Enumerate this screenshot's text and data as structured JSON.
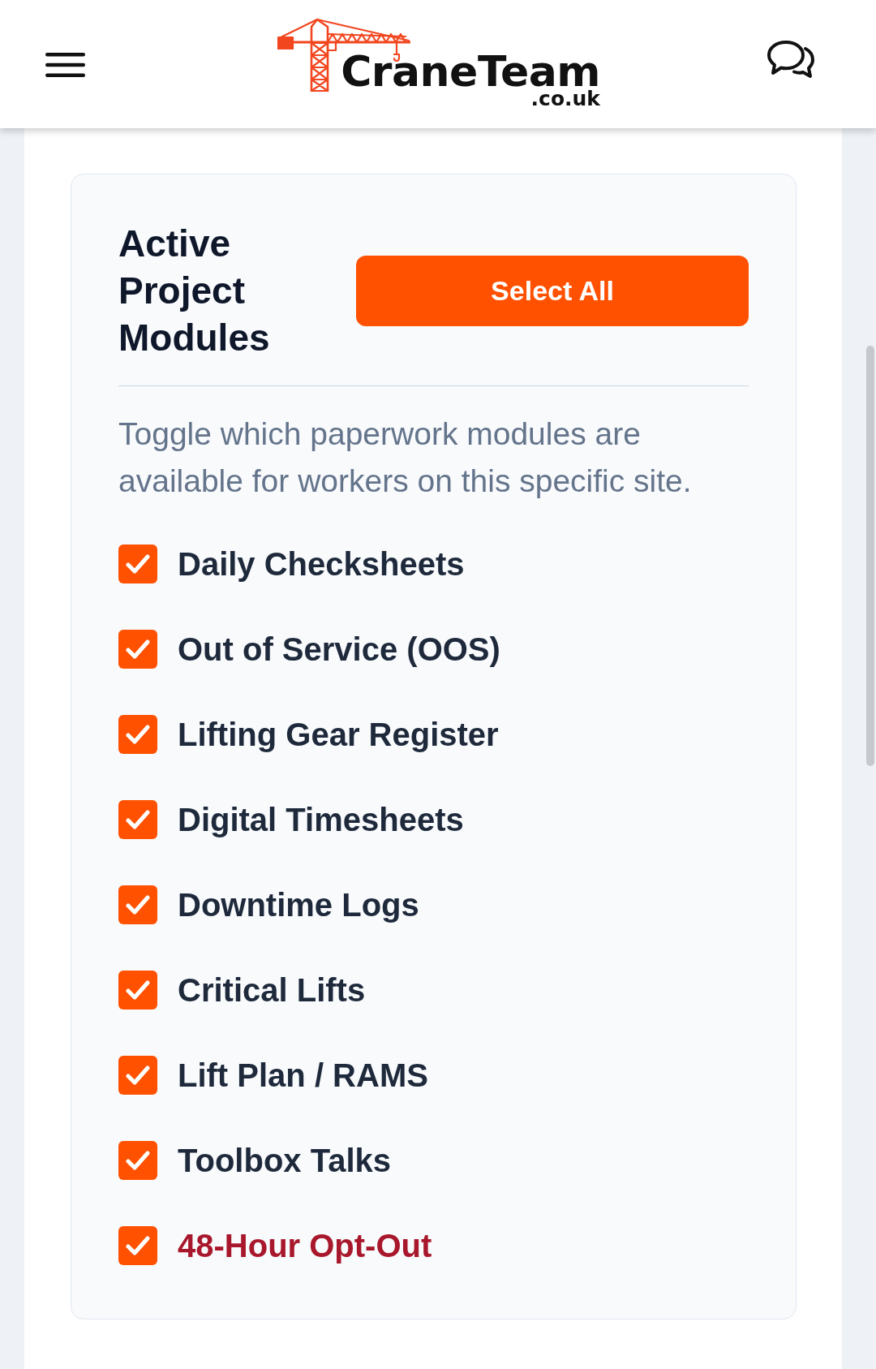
{
  "header": {
    "logo": {
      "name": "CraneTeam",
      "domain": ".co.uk"
    }
  },
  "panel": {
    "title": "Active Project Modules",
    "select_all_button": "Select All",
    "description": "Toggle which paperwork modules are available for workers on this specific site."
  },
  "modules": [
    {
      "label": "Daily Checksheets",
      "checked": true,
      "color": "#1e293b"
    },
    {
      "label": "Out of Service (OOS)",
      "checked": true,
      "color": "#1e293b"
    },
    {
      "label": "Lifting Gear Register",
      "checked": true,
      "color": "#1e293b"
    },
    {
      "label": "Digital Timesheets",
      "checked": true,
      "color": "#1e293b"
    },
    {
      "label": "Downtime Logs",
      "checked": true,
      "color": "#1e293b"
    },
    {
      "label": "Critical Lifts",
      "checked": true,
      "color": "#1e293b"
    },
    {
      "label": "Lift Plan / RAMS",
      "checked": true,
      "color": "#1e293b"
    },
    {
      "label": "Toolbox Talks",
      "checked": true,
      "color": "#1e293b"
    },
    {
      "label": "48-Hour Opt-Out",
      "checked": true,
      "color": "#a8172b"
    }
  ]
}
